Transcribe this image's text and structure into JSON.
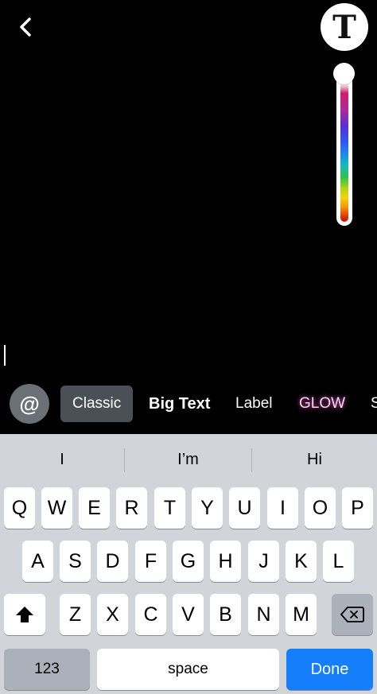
{
  "top_bar": {
    "back_icon": "chevron-left-icon",
    "text_tool_label": "T"
  },
  "color_slider": {
    "selected_color": "#ffffff",
    "level": 0
  },
  "mention_label": "@",
  "styles": [
    {
      "label": "Classic",
      "selected": true
    },
    {
      "label": "Big Text",
      "selected": false
    },
    {
      "label": "Label",
      "selected": false
    },
    {
      "label": "GLOW",
      "selected": false
    },
    {
      "label": "S",
      "selected": false
    }
  ],
  "keyboard": {
    "suggestions": [
      "I",
      "I’m",
      "Hi"
    ],
    "row1": [
      "Q",
      "W",
      "E",
      "R",
      "T",
      "Y",
      "U",
      "I",
      "O",
      "P"
    ],
    "row2": [
      "A",
      "S",
      "D",
      "F",
      "G",
      "H",
      "J",
      "K",
      "L"
    ],
    "row3": [
      "Z",
      "X",
      "C",
      "V",
      "B",
      "N",
      "M"
    ],
    "shift_icon": "shift-arrow-icon",
    "delete_icon": "backspace-icon",
    "numbers_label": "123",
    "space_label": "space",
    "done_label": "Done",
    "colors": {
      "background": "#d1d4d9",
      "done": "#147efb",
      "func_key": "#abb0ba"
    }
  }
}
